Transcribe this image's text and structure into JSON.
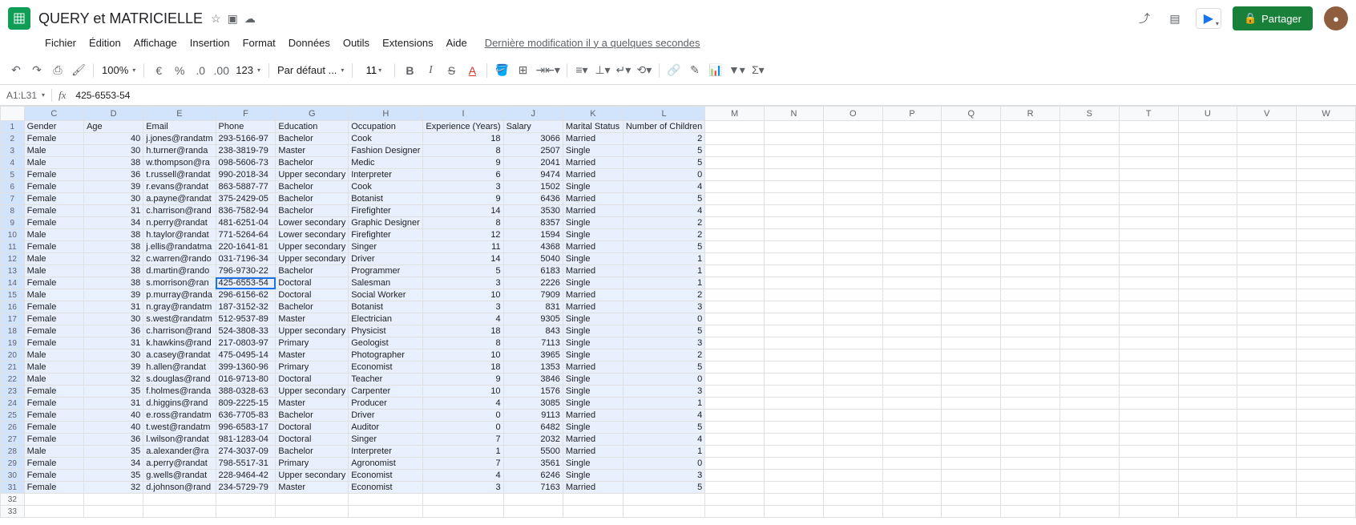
{
  "doc": {
    "title": "QUERY et MATRICIELLE"
  },
  "menu": {
    "file": "Fichier",
    "edit": "Édition",
    "view": "Affichage",
    "insert": "Insertion",
    "format": "Format",
    "data": "Données",
    "tools": "Outils",
    "ext": "Extensions",
    "help": "Aide",
    "last_edit": "Dernière modification il y a quelques secondes"
  },
  "share": {
    "label": "Partager"
  },
  "toolbar": {
    "zoom": "100%",
    "font": "Par défaut ...",
    "font_size": "11",
    "number_fmt": "123"
  },
  "namebox": "A1:L31",
  "formula": "425-6553-54",
  "columns": [
    "C",
    "D",
    "E",
    "F",
    "G",
    "H",
    "I",
    "J",
    "K",
    "L",
    "M",
    "N",
    "O",
    "P",
    "Q",
    "R",
    "S",
    "T",
    "U",
    "V",
    "W"
  ],
  "selected_cols": [
    "C",
    "D",
    "E",
    "F",
    "G",
    "H",
    "I",
    "J",
    "K",
    "L"
  ],
  "selected_row_max": 31,
  "chart_data": {
    "type": "table",
    "headers": [
      "Gender",
      "Age",
      "Email",
      "Phone",
      "Education",
      "Occupation",
      "Experience (Years)",
      "Salary",
      "Marital Status",
      "Number of Children"
    ],
    "rows": [
      [
        "Female",
        40,
        "j.jones@randatm",
        "293-5166-97",
        "Bachelor",
        "Cook",
        18,
        3066,
        "Married",
        2
      ],
      [
        "Male",
        30,
        "h.turner@randa",
        "238-3819-79",
        "Master",
        "Fashion Designer",
        8,
        2507,
        "Single",
        5
      ],
      [
        "Male",
        38,
        "w.thompson@ra",
        "098-5606-73",
        "Bachelor",
        "Medic",
        9,
        2041,
        "Married",
        5
      ],
      [
        "Female",
        36,
        "t.russell@randat",
        "990-2018-34",
        "Upper secondary",
        "Interpreter",
        6,
        9474,
        "Married",
        0
      ],
      [
        "Female",
        39,
        "r.evans@randat",
        "863-5887-77",
        "Bachelor",
        "Cook",
        3,
        1502,
        "Single",
        4
      ],
      [
        "Female",
        30,
        "a.payne@randat",
        "375-2429-05",
        "Bachelor",
        "Botanist",
        9,
        6436,
        "Married",
        5
      ],
      [
        "Female",
        31,
        "c.harrison@rand",
        "836-7582-94",
        "Bachelor",
        "Firefighter",
        14,
        3530,
        "Married",
        4
      ],
      [
        "Female",
        34,
        "n.perry@randat",
        "481-6251-04",
        "Lower secondary",
        "Graphic Designer",
        8,
        8357,
        "Single",
        2
      ],
      [
        "Male",
        38,
        "h.taylor@randat",
        "771-5264-64",
        "Lower secondary",
        "Firefighter",
        12,
        1594,
        "Single",
        2
      ],
      [
        "Female",
        38,
        "j.ellis@randatma",
        "220-1641-81",
        "Upper secondary",
        "Singer",
        11,
        4368,
        "Married",
        5
      ],
      [
        "Male",
        32,
        "c.warren@rando",
        "031-7196-34",
        "Upper secondary",
        "Driver",
        14,
        5040,
        "Single",
        1
      ],
      [
        "Male",
        38,
        "d.martin@rando",
        "796-9730-22",
        "Bachelor",
        "Programmer",
        5,
        6183,
        "Married",
        1
      ],
      [
        "Female",
        38,
        "s.morrison@ran",
        "425-6553-54",
        "Doctoral",
        "Salesman",
        3,
        2226,
        "Single",
        1
      ],
      [
        "Male",
        39,
        "p.murray@randa",
        "296-6156-62",
        "Doctoral",
        "Social Worker",
        10,
        7909,
        "Married",
        2
      ],
      [
        "Female",
        31,
        "n.gray@randatm",
        "187-3152-32",
        "Bachelor",
        "Botanist",
        3,
        831,
        "Married",
        3
      ],
      [
        "Female",
        30,
        "s.west@randatm",
        "512-9537-89",
        "Master",
        "Electrician",
        4,
        9305,
        "Single",
        0
      ],
      [
        "Female",
        36,
        "c.harrison@rand",
        "524-3808-33",
        "Upper secondary",
        "Physicist",
        18,
        843,
        "Single",
        5
      ],
      [
        "Female",
        31,
        "k.hawkins@rand",
        "217-0803-97",
        "Primary",
        "Geologist",
        8,
        7113,
        "Single",
        3
      ],
      [
        "Male",
        30,
        "a.casey@randat",
        "475-0495-14",
        "Master",
        "Photographer",
        10,
        3965,
        "Single",
        2
      ],
      [
        "Male",
        39,
        "h.allen@randat",
        "399-1360-96",
        "Primary",
        "Economist",
        18,
        1353,
        "Married",
        5
      ],
      [
        "Male",
        32,
        "s.douglas@rand",
        "016-9713-80",
        "Doctoral",
        "Teacher",
        9,
        3846,
        "Single",
        0
      ],
      [
        "Female",
        35,
        "f.holmes@randa",
        "388-0328-63",
        "Upper secondary",
        "Carpenter",
        10,
        1576,
        "Single",
        3
      ],
      [
        "Female",
        31,
        "d.higgins@rand",
        "809-2225-15",
        "Master",
        "Producer",
        4,
        3085,
        "Single",
        1
      ],
      [
        "Female",
        40,
        "e.ross@randatm",
        "636-7705-83",
        "Bachelor",
        "Driver",
        0,
        9113,
        "Married",
        4
      ],
      [
        "Female",
        40,
        "t.west@randatm",
        "996-6583-17",
        "Doctoral",
        "Auditor",
        0,
        6482,
        "Single",
        5
      ],
      [
        "Female",
        36,
        "l.wilson@randat",
        "981-1283-04",
        "Doctoral",
        "Singer",
        7,
        2032,
        "Married",
        4
      ],
      [
        "Male",
        35,
        "a.alexander@ra",
        "274-3037-09",
        "Bachelor",
        "Interpreter",
        1,
        5500,
        "Married",
        1
      ],
      [
        "Female",
        34,
        "a.perry@randat",
        "798-5517-31",
        "Primary",
        "Agronomist",
        7,
        3561,
        "Single",
        0
      ],
      [
        "Female",
        35,
        "g.wells@randat",
        "228-9464-42",
        "Upper secondary",
        "Economist",
        4,
        6246,
        "Single",
        3
      ],
      [
        "Female",
        32,
        "d.johnson@rand",
        "234-5729-79",
        "Master",
        "Economist",
        3,
        7163,
        "Married",
        5
      ]
    ]
  },
  "active_cell": {
    "row": 14,
    "col": "F"
  }
}
